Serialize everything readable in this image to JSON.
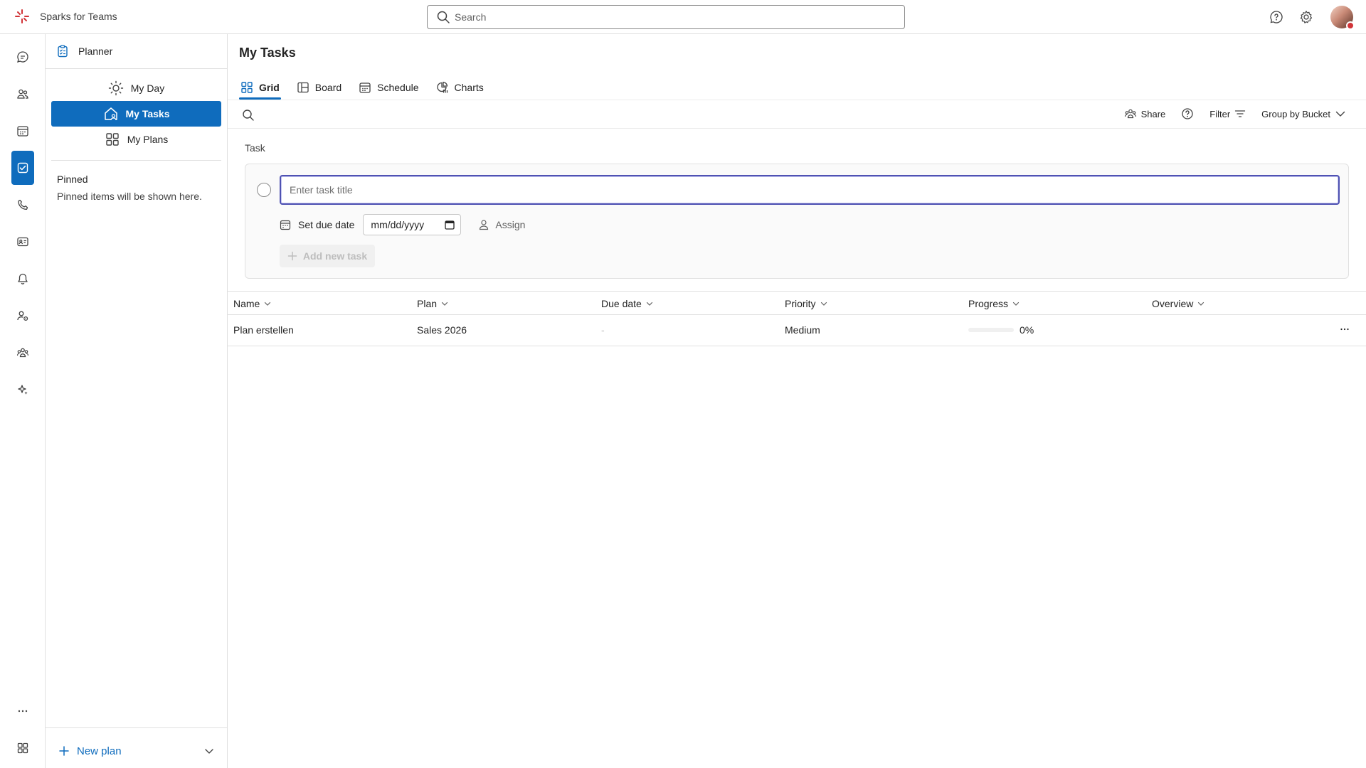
{
  "app": {
    "title": "Sparks for Teams"
  },
  "search": {
    "placeholder": "Search"
  },
  "side_panel": {
    "header": "Planner",
    "nav": [
      {
        "label": "My Day",
        "icon": "sun-icon"
      },
      {
        "label": "My Tasks",
        "icon": "home-person-icon",
        "selected": true
      },
      {
        "label": "My Plans",
        "icon": "grid-icon"
      }
    ],
    "pinned_title": "Pinned",
    "pinned_note": "Pinned items will be shown here.",
    "new_plan": "New plan"
  },
  "main": {
    "title": "My Tasks",
    "tabs": [
      {
        "label": "Grid",
        "active": true
      },
      {
        "label": "Board"
      },
      {
        "label": "Schedule"
      },
      {
        "label": "Charts"
      }
    ],
    "toolbar": {
      "share": "Share",
      "filter": "Filter",
      "group_by": "Group by Bucket"
    },
    "task_form": {
      "label": "Task",
      "title_placeholder": "Enter task title",
      "set_due_date": "Set due date",
      "date_placeholder": "mm/dd/yyyy",
      "assign": "Assign",
      "add_button": "Add new task"
    },
    "grid": {
      "columns": [
        "Name",
        "Plan",
        "Due date",
        "Priority",
        "Progress",
        "Overview"
      ],
      "rows": [
        {
          "name": "Plan erstellen",
          "plan": "Sales 2026",
          "due": "-",
          "priority": "Medium",
          "progress_label": "0%",
          "progress_value": 0
        }
      ]
    }
  },
  "colors": {
    "accent": "#0f6cbd",
    "focus": "#4f52b2",
    "brand_logo": "#d13438"
  }
}
